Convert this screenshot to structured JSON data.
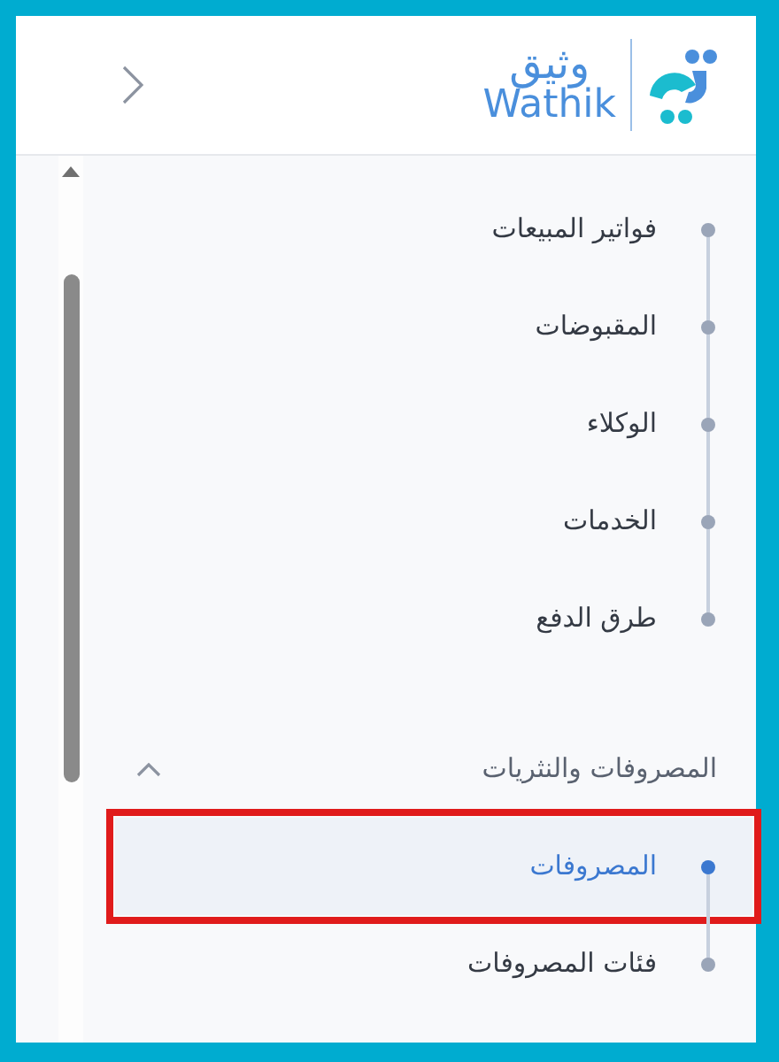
{
  "logo": {
    "arabic": "وثيق",
    "latin": "Wathik"
  },
  "items": [
    {
      "label": "فواتير المبيعات",
      "selected": false
    },
    {
      "label": "المقبوضات",
      "selected": false
    },
    {
      "label": "الوكلاء",
      "selected": false
    },
    {
      "label": "الخدمات",
      "selected": false
    },
    {
      "label": "طرق الدفع",
      "selected": false
    }
  ],
  "group": {
    "title": "المصروفات والنثريات",
    "expanded": true,
    "items": [
      {
        "label": "المصروفات",
        "selected": true,
        "outlined": true
      },
      {
        "label": "فئات المصروفات",
        "selected": false,
        "outlined": false
      }
    ]
  }
}
